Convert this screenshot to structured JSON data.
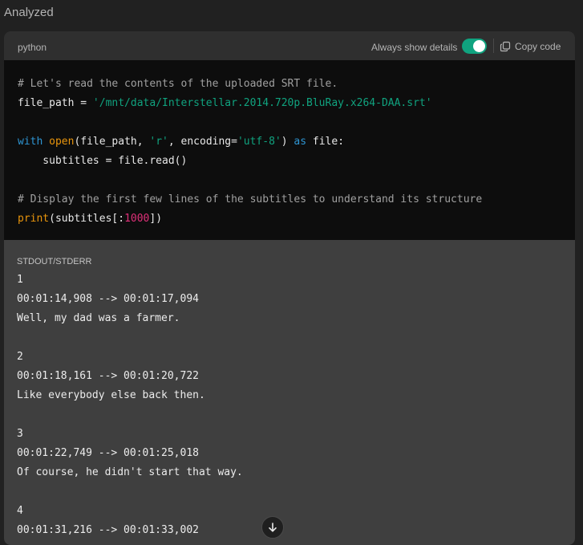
{
  "status": "Analyzed",
  "code_block": {
    "language": "python",
    "details_label": "Always show details",
    "details_toggle_on": true,
    "copy_label": "Copy code",
    "colors": {
      "toggle": "#10a37f",
      "string": "#10a37f",
      "keyword": "#2e95d3",
      "builtin": "#e9950c",
      "number": "#df3079",
      "comment": "#a0a0a0"
    },
    "lines": {
      "l1_comment": "# Let's read the contents of the uploaded SRT file.",
      "l2_var": "file_path = ",
      "l2_str": "'/mnt/data/Interstellar.2014.720p.BluRay.x264-DAA.srt'",
      "l4_kw_with": "with",
      "l4_fn_open": "open",
      "l4_args": "(file_path, ",
      "l4_str_r": "'r'",
      "l4_enc": ", encoding=",
      "l4_str_utf": "'utf-8'",
      "l4_close": ") ",
      "l4_kw_as": "as",
      "l4_tail": " file:",
      "l5": "    subtitles = file.read()",
      "l7_comment": "# Display the first few lines of the subtitles to understand its structure",
      "l8_fn_print": "print",
      "l8_open": "(subtitles[:",
      "l8_num": "1000",
      "l8_close": "])"
    }
  },
  "output": {
    "label": "STDOUT/STDERR",
    "text": "1\n00:01:14,908 --> 00:01:17,094\nWell, my dad was a farmer.\n\n2\n00:01:18,161 --> 00:01:20,722\nLike everybody else back then.\n\n3\n00:01:22,749 --> 00:01:25,018\nOf course, he didn't start that way.\n\n4\n00:01:31,216 --> 00:01:33,002"
  },
  "scroll_button_icon": "arrow-down-icon"
}
